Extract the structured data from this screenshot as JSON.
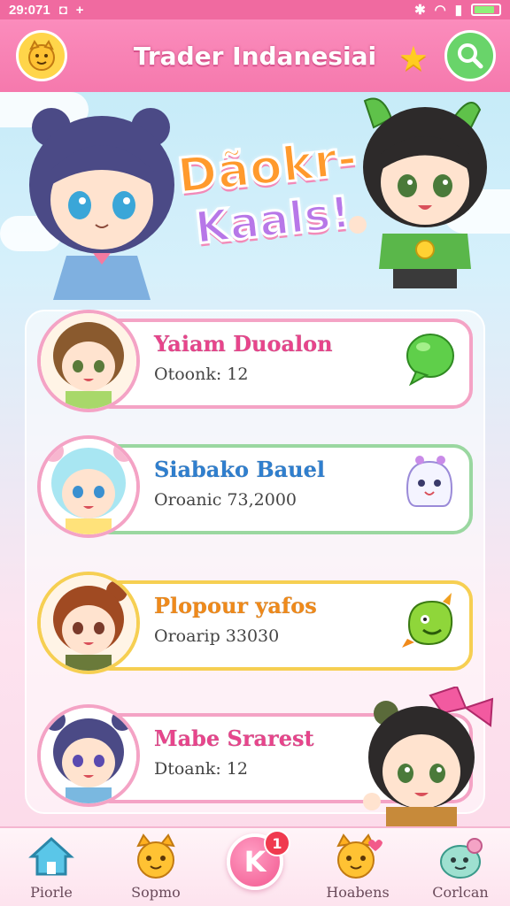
{
  "status_bar": {
    "time": "29:071"
  },
  "header": {
    "title": "Trader Indanesiai"
  },
  "hero": {
    "logo_line1": "Dãokr-",
    "logo_line2": "Kaals!"
  },
  "traders": [
    {
      "name": "Yaiam Duoalon",
      "detail": "Otoonk: 12",
      "name_color": "#e8458c",
      "border_color": "#f4a3c5",
      "badge": "speech-bubble-icon"
    },
    {
      "name": "Siabako Bauel",
      "detail": "Oroanic 73,2000",
      "name_color": "#2f7fcf",
      "border_color": "#9ad7a0",
      "badge": "ghost-mascot-icon"
    },
    {
      "name": "Plopour yafos",
      "detail": "Oroarip 33030",
      "name_color": "#f08a1a",
      "border_color": "#f6cf52",
      "badge": "green-monster-icon"
    },
    {
      "name": "Mabe Srarest",
      "detail": "Dtoank: 12",
      "name_color": "#e8458c",
      "border_color": "#f4a3c5",
      "badge": "character-sticker-icon"
    }
  ],
  "nav": {
    "items": [
      {
        "label": "Piorle",
        "icon": "home-icon"
      },
      {
        "label": "Sopmo",
        "icon": "cat-face-icon"
      },
      {
        "label": "Hoabens",
        "icon": "cat-heart-icon"
      },
      {
        "label": "Corlcan",
        "icon": "creature-icon"
      }
    ],
    "fab_letter": "K",
    "fab_count": "1"
  },
  "colors": {
    "primary_pink": "#f579ad",
    "accent_green": "#69d46a",
    "accent_yellow": "#ffd54a"
  }
}
